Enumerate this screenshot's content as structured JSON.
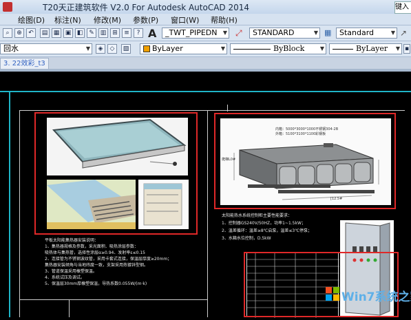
{
  "app": {
    "title": "T20天正建筑软件 V2.0 For Autodesk AutoCAD 2014",
    "search_placeholder": "键入"
  },
  "menu": [
    "绘图(D)",
    "标注(N)",
    "修改(M)",
    "参数(P)",
    "窗口(W)",
    "帮助(H)"
  ],
  "toolbar1": {
    "text_style": "_TWT_PIPEDN",
    "dim_style": "STANDARD",
    "table_style": "Standard"
  },
  "toolbar2": {
    "layer": "回水",
    "color": "ByLayer",
    "linetype": "ByBlock",
    "lineweight": "ByLayer"
  },
  "tabs": [
    "3. 22效彩_t3"
  ],
  "drawing": {
    "water_tank_dim_line1": "内箱：5000*3000*1000不锈钢304-2B",
    "water_tank_dim_line2": "外箱：5100*3100*1100彩钢板",
    "tank_label_left": "爬梯L0#",
    "tank_label_bottom": "[12.5#",
    "left_notes": [
      "平板太阳能集热器安装说明：",
      "1、集热器规格及参数，采光面积、吸热涂层参数：",
      "   吸热体与集热管，选择性涂层α≥0.94、发射率ε≤0.15",
      "2、连接管为不锈钢波纹管，采用卡套式连接，保温层厚度≥20mm；",
      "   集热器安装倾角与当地纬度一致，支架采用热镀锌型钢。",
      "3、管道保温采用橡塑保温。",
      "4、系统试压及调试。",
      "5、保温层30mm厚橡塑保温，导热系数0.055W/(m·k)"
    ],
    "right_notes": [
      "太阳能热水系统控制柜主要性能要求：",
      "1、控制器GS240V/50HZ，功率1~1.5kW；",
      "2、温差循环：温差≥8℃启泵，温差≤3℃停泵；",
      "3、水箱水位控制，D.5kW"
    ]
  },
  "watermark": {
    "brand": "Win7系统之家"
  }
}
